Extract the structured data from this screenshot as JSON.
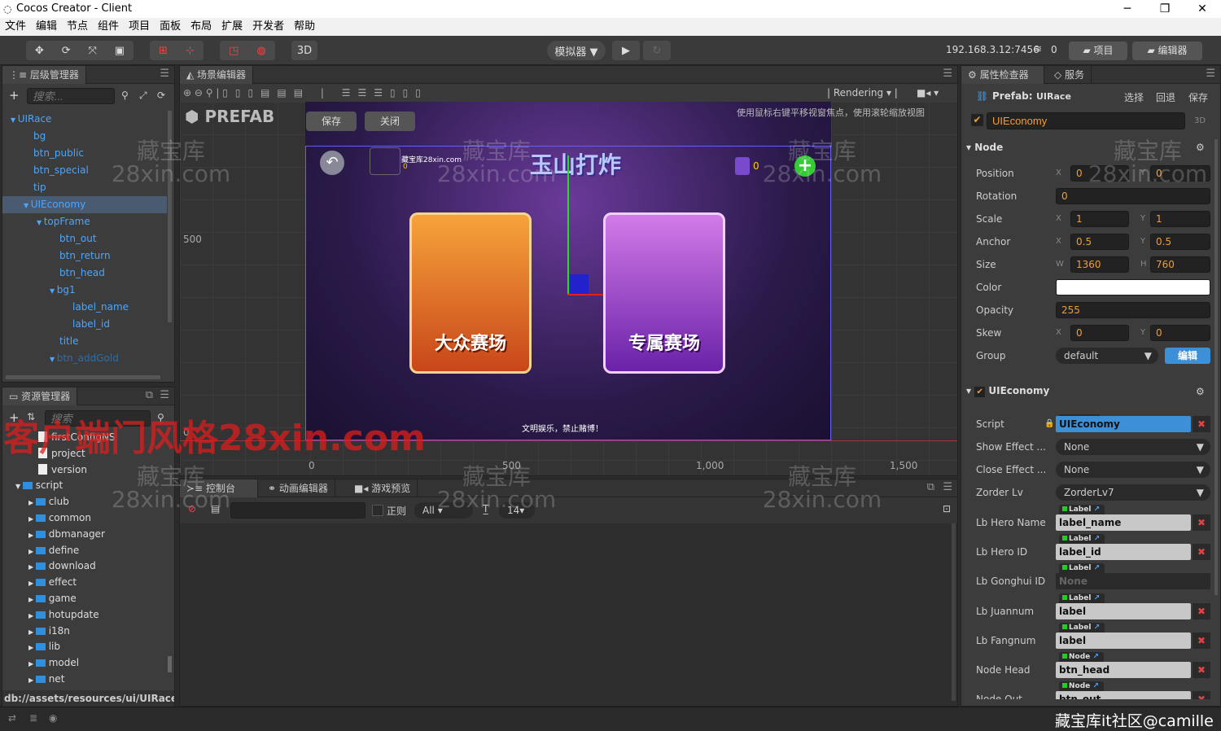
{
  "window": {
    "title": "Cocos Creator - Client",
    "minimize": "─",
    "maximize": "❐",
    "close": "✕"
  },
  "menu": [
    "文件",
    "编辑",
    "节点",
    "组件",
    "项目",
    "面板",
    "布局",
    "扩展",
    "开发者",
    "帮助"
  ],
  "toolbar": {
    "mode_3d": "3D",
    "simulator": "模拟器 ▼",
    "play": "▶",
    "refresh": "↻",
    "ip": "192.168.3.12:7456",
    "connections": "0",
    "project_btn": "项目",
    "editor_btn": "编辑器"
  },
  "hierarchy": {
    "tab": "层级管理器",
    "search_placeholder": "搜索...",
    "nodes": [
      {
        "label": "UIRace",
        "depth": 0,
        "arrow": "▼"
      },
      {
        "label": "bg",
        "depth": 1
      },
      {
        "label": "btn_public",
        "depth": 1
      },
      {
        "label": "btn_special",
        "depth": 1
      },
      {
        "label": "tip",
        "depth": 1
      },
      {
        "label": "UIEconomy",
        "depth": 1,
        "arrow": "▼",
        "selected": true
      },
      {
        "label": "topFrame",
        "depth": 2,
        "arrow": "▼"
      },
      {
        "label": "btn_out",
        "depth": 3
      },
      {
        "label": "btn_return",
        "depth": 3
      },
      {
        "label": "btn_head",
        "depth": 3
      },
      {
        "label": "bg1",
        "depth": 3,
        "arrow": "▼"
      },
      {
        "label": "label_name",
        "depth": 4
      },
      {
        "label": "label_id",
        "depth": 4
      },
      {
        "label": "title",
        "depth": 3
      },
      {
        "label": "btn_addGold",
        "depth": 3,
        "arrow": "▼"
      }
    ]
  },
  "assets": {
    "tab": "资源管理器",
    "search_placeholder": "搜索",
    "items": [
      {
        "label": "firstConfigNS",
        "type": "file",
        "depth": 1
      },
      {
        "label": "project",
        "type": "file",
        "depth": 1
      },
      {
        "label": "version",
        "type": "file",
        "depth": 1
      },
      {
        "label": "script",
        "type": "folder",
        "depth": 0,
        "arrow": "▼"
      },
      {
        "label": "club",
        "type": "folder",
        "depth": 1,
        "arrow": "▶"
      },
      {
        "label": "common",
        "type": "folder",
        "depth": 1,
        "arrow": "▶"
      },
      {
        "label": "dbmanager",
        "type": "folder",
        "depth": 1,
        "arrow": "▶"
      },
      {
        "label": "define",
        "type": "folder",
        "depth": 1,
        "arrow": "▶"
      },
      {
        "label": "download",
        "type": "folder",
        "depth": 1,
        "arrow": "▶"
      },
      {
        "label": "effect",
        "type": "folder",
        "depth": 1,
        "arrow": "▶"
      },
      {
        "label": "game",
        "type": "folder",
        "depth": 1,
        "arrow": "▶"
      },
      {
        "label": "hotupdate",
        "type": "folder",
        "depth": 1,
        "arrow": "▶"
      },
      {
        "label": "i18n",
        "type": "folder",
        "depth": 1,
        "arrow": "▶"
      },
      {
        "label": "lib",
        "type": "folder",
        "depth": 1,
        "arrow": "▶"
      },
      {
        "label": "model",
        "type": "folder",
        "depth": 1,
        "arrow": "▶"
      },
      {
        "label": "net",
        "type": "folder",
        "depth": 1,
        "arrow": "▶"
      }
    ],
    "path": "db://assets/resources/ui/UIRace...."
  },
  "scene": {
    "tab": "场景编辑器",
    "rendering": "Rendering",
    "prefab_label": "PREFAB",
    "save": "保存",
    "close": "关闭",
    "hint": "使用鼠标右键平移视窗焦点，使用滚轮缩放视图",
    "ruler_y": [
      "500",
      "0"
    ],
    "ruler_x": [
      "0",
      "500",
      "1,000",
      "1,500"
    ],
    "game": {
      "player_name": "藏宝库28xin.com",
      "player_value": "0",
      "title": "玉山打炸",
      "gem_count": "0",
      "card_left": "大众赛场",
      "card_right": "专属赛场",
      "footer": "文明娱乐，禁止赌博！"
    }
  },
  "console": {
    "tabs": [
      "控制台",
      "动画编辑器",
      "游戏预览"
    ],
    "regex": "正则",
    "level": "All",
    "font_size": "14"
  },
  "inspector": {
    "tabs": [
      "属性检查器",
      "服务"
    ],
    "prefab_label": "Prefab:",
    "prefab_name": "UIRace",
    "select": "选择",
    "revert": "回退",
    "save": "保存",
    "node_name": "UIEconomy",
    "d3": "3D",
    "node_section": "Node",
    "props": {
      "position": {
        "label": "Position",
        "x": "0",
        "y": "0"
      },
      "rotation": {
        "label": "Rotation",
        "value": "0"
      },
      "scale": {
        "label": "Scale",
        "x": "1",
        "y": "1"
      },
      "anchor": {
        "label": "Anchor",
        "x": "0.5",
        "y": "0.5"
      },
      "size": {
        "label": "Size",
        "w": "1360",
        "h": "760"
      },
      "color": {
        "label": "Color",
        "value": "#ffffff"
      },
      "opacity": {
        "label": "Opacity",
        "value": "255"
      },
      "skew": {
        "label": "Skew",
        "x": "0",
        "y": "0"
      },
      "group": {
        "label": "Group",
        "value": "default",
        "edit": "编辑"
      }
    },
    "component": {
      "name": "UIEconomy",
      "fields": [
        {
          "label": "Script",
          "kind": "script",
          "tag": "script",
          "value": "UIEconomy"
        },
        {
          "label": "Show Effect ...",
          "kind": "select",
          "value": "None"
        },
        {
          "label": "Close Effect ...",
          "kind": "select",
          "value": "None"
        },
        {
          "label": "Zorder Lv",
          "kind": "select",
          "value": "ZorderLv7"
        },
        {
          "label": "Lb Hero Name",
          "kind": "ref",
          "tag": "Label",
          "value": "label_name"
        },
        {
          "label": "Lb Hero ID",
          "kind": "ref",
          "tag": "Label",
          "value": "label_id"
        },
        {
          "label": "Lb Gonghui ID",
          "kind": "empty",
          "tag": "Label",
          "value": "None"
        },
        {
          "label": "Lb Juannum",
          "kind": "ref",
          "tag": "Label",
          "value": "label"
        },
        {
          "label": "Lb Fangnum",
          "kind": "ref",
          "tag": "Label",
          "value": "label"
        },
        {
          "label": "Node Head",
          "kind": "ref",
          "tag": "Node",
          "value": "btn_head"
        },
        {
          "label": "Node Out",
          "kind": "ref",
          "tag": "Node",
          "value": "btn_out"
        }
      ]
    }
  },
  "watermarks": {
    "overlay": "客户端门风格28xin.com",
    "corner": "藏宝库it社区@camille",
    "tile": "藏宝库 28xin.com"
  },
  "colors": {
    "accent": "#f39c36",
    "link": "#4aa6ff",
    "selected_script": "#3d8fd6"
  }
}
